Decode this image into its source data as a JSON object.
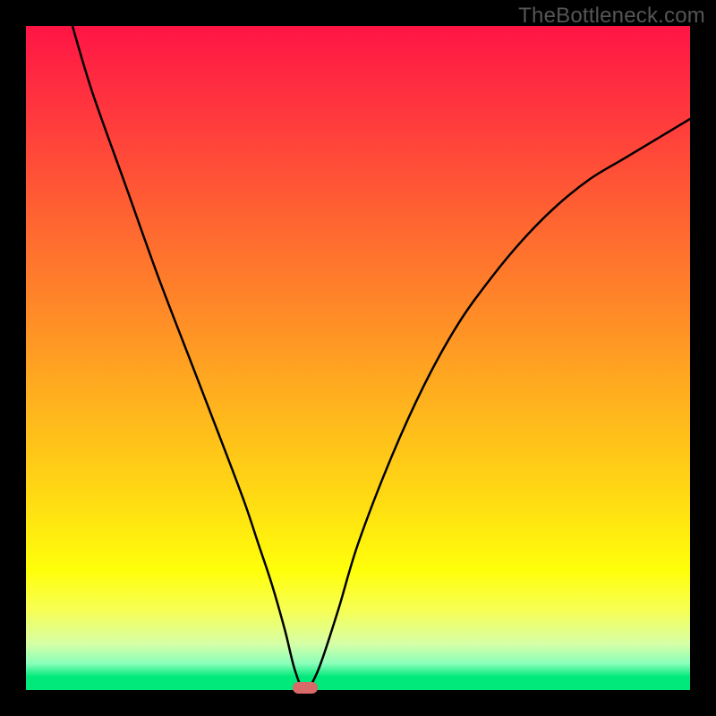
{
  "watermark": "TheBottleneck.com",
  "marker_color": "#d86a6a",
  "chart_data": {
    "type": "line",
    "title": "",
    "xlabel": "",
    "ylabel": "",
    "xlim": [
      0,
      100
    ],
    "ylim": [
      0,
      100
    ],
    "series": [
      {
        "name": "curve",
        "x": [
          7,
          10,
          15,
          20,
          25,
          30,
          33,
          35,
          37,
          39,
          40.5,
          42,
          44,
          47,
          50,
          55,
          60,
          65,
          70,
          75,
          80,
          85,
          90,
          95,
          100
        ],
        "y": [
          100,
          90,
          76,
          62,
          49,
          36,
          28,
          22,
          16,
          9,
          3,
          0,
          3,
          12,
          22,
          35,
          46,
          55,
          62,
          68,
          73,
          77,
          80,
          83,
          86
        ]
      }
    ],
    "marker": {
      "x": 42,
      "y": 0
    },
    "background_gradient": {
      "top": "#ff1545",
      "bottom": "#00e97a",
      "bands": [
        "red",
        "orange",
        "yellow",
        "green"
      ]
    }
  }
}
